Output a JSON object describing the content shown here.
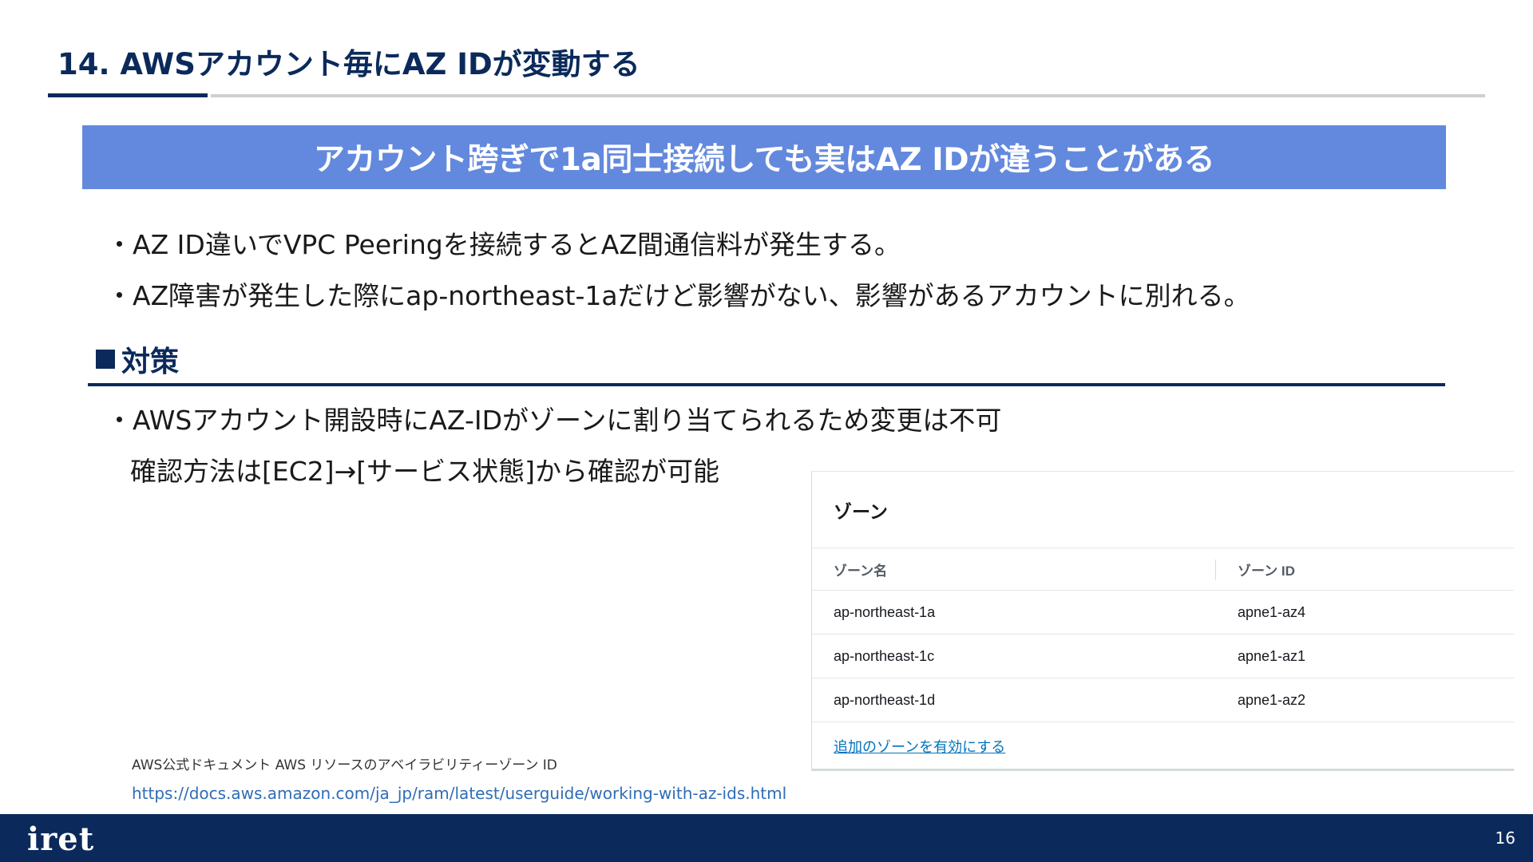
{
  "slide": {
    "title": "14.  AWSアカウント毎にAZ IDが変動する",
    "headline": "アカウント跨ぎで1a同士接続しても実はAZ IDが違うことがある",
    "bullets": [
      "・AZ ID違いでVPC Peeringを接続するとAZ間通信料が発生する。",
      "・AZ障害が発生した際にap-northeast-1aだけど影響がない、影響があるアカウントに別れる。"
    ],
    "section": {
      "marker": "■",
      "heading": "対策",
      "bullets": [
        "・AWSアカウント開設時にAZ-IDがゾーンに割り当てられるため変更は不可",
        "確認方法は[EC2]→[サービス状態]から確認が可能"
      ]
    }
  },
  "console": {
    "title": "ゾーン",
    "columns": {
      "name": "ゾーン名",
      "id": "ゾーン ID"
    },
    "rows": [
      {
        "name": "ap-northeast-1a",
        "id": "apne1-az4"
      },
      {
        "name": "ap-northeast-1c",
        "id": "apne1-az1"
      },
      {
        "name": "ap-northeast-1d",
        "id": "apne1-az2"
      }
    ],
    "link": "追加のゾーンを有効にする"
  },
  "reference": {
    "caption": "AWS公式ドキュメント AWS リソースのアベイラビリティーゾーン ID",
    "url": "https://docs.aws.amazon.com/ja_jp/ram/latest/userguide/working-with-az-ids.html"
  },
  "footer": {
    "logo": "iret",
    "page_number": "16"
  },
  "colors": {
    "brand_navy": "#0b2a5b",
    "banner_blue": "#6389de",
    "link_blue": "#0073bb"
  }
}
